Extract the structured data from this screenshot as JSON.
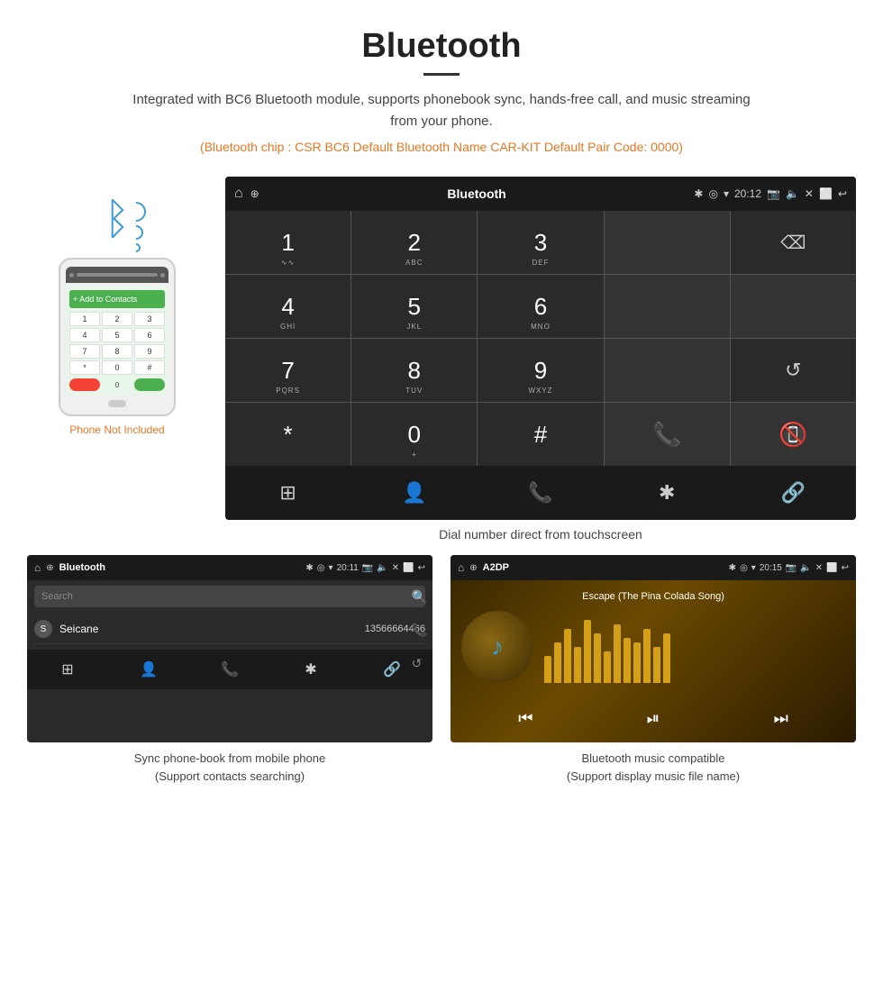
{
  "header": {
    "title": "Bluetooth",
    "description": "Integrated with BC6 Bluetooth module, supports phonebook sync, hands-free call, and music streaming from your phone.",
    "spec_line": "(Bluetooth chip : CSR BC6    Default Bluetooth Name CAR-KIT    Default Pair Code: 0000)"
  },
  "phone_label": "Phone Not Included",
  "main_screen": {
    "topbar": {
      "title": "Bluetooth",
      "usb_icon": "⊕",
      "time": "20:12"
    },
    "dialpad": {
      "keys": [
        {
          "num": "1",
          "sub": "∿∿"
        },
        {
          "num": "2",
          "sub": "ABC"
        },
        {
          "num": "3",
          "sub": "DEF"
        },
        {
          "num": "",
          "sub": ""
        },
        {
          "num": "⌫",
          "sub": ""
        },
        {
          "num": "4",
          "sub": "GHI"
        },
        {
          "num": "5",
          "sub": "JKL"
        },
        {
          "num": "6",
          "sub": "MNO"
        },
        {
          "num": "",
          "sub": ""
        },
        {
          "num": "",
          "sub": ""
        },
        {
          "num": "7",
          "sub": "PQRS"
        },
        {
          "num": "8",
          "sub": "TUV"
        },
        {
          "num": "9",
          "sub": "WXYZ"
        },
        {
          "num": "",
          "sub": ""
        },
        {
          "num": "↺",
          "sub": ""
        },
        {
          "num": "*",
          "sub": ""
        },
        {
          "num": "0",
          "sub": "+"
        },
        {
          "num": "#",
          "sub": ""
        },
        {
          "num": "📞",
          "sub": ""
        },
        {
          "num": "📵",
          "sub": ""
        }
      ]
    },
    "bottom_items": [
      "⊞",
      "👤",
      "📞",
      "✱",
      "🔗"
    ]
  },
  "dial_caption": "Dial number direct from touchscreen",
  "contact_screen": {
    "topbar_title": "Bluetooth",
    "time": "20:11",
    "search_placeholder": "Search",
    "contacts": [
      {
        "letter": "S",
        "name": "Seicane",
        "number": "13566664466"
      }
    ]
  },
  "music_screen": {
    "topbar_title": "A2DP",
    "time": "20:15",
    "song_title": "Escape (The Pina Colada Song)",
    "visualizer_bars": [
      30,
      45,
      60,
      40,
      70,
      55,
      35,
      65,
      50,
      45,
      60,
      40,
      55
    ]
  },
  "bottom_captions": {
    "contacts": "Sync phone-book from mobile phone\n(Support contacts searching)",
    "music": "Bluetooth music compatible\n(Support display music file name)"
  }
}
